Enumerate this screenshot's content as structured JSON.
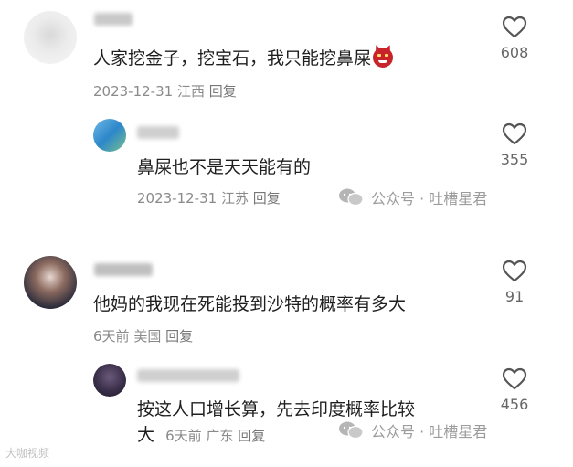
{
  "comments": [
    {
      "text": "人家挖金子，挖宝石，我只能挖鼻屎",
      "date": "2023-12-31",
      "location": "江西",
      "reply_label": "回复",
      "likes": "608"
    },
    {
      "text": "鼻屎也不是天天能有的",
      "date": "2023-12-31",
      "location": "江苏",
      "reply_label": "回复",
      "likes": "355"
    },
    {
      "text": "他妈的我现在死能投到沙特的概率有多大",
      "date": "6天前",
      "location": "美国",
      "reply_label": "回复",
      "likes": "91"
    },
    {
      "text_line1": "按这人口增长算，先去印度概率比较",
      "text_line2": "大",
      "date": "6天前",
      "location": "广东",
      "reply_label": "回复",
      "likes": "456"
    }
  ],
  "watermark": "公众号 · 吐槽星君",
  "corner_watermark": "大咖视频",
  "icons": {
    "like": "heart-outline-icon",
    "watermark": "wechat-icon",
    "emoji": "devil-face-emoji"
  }
}
